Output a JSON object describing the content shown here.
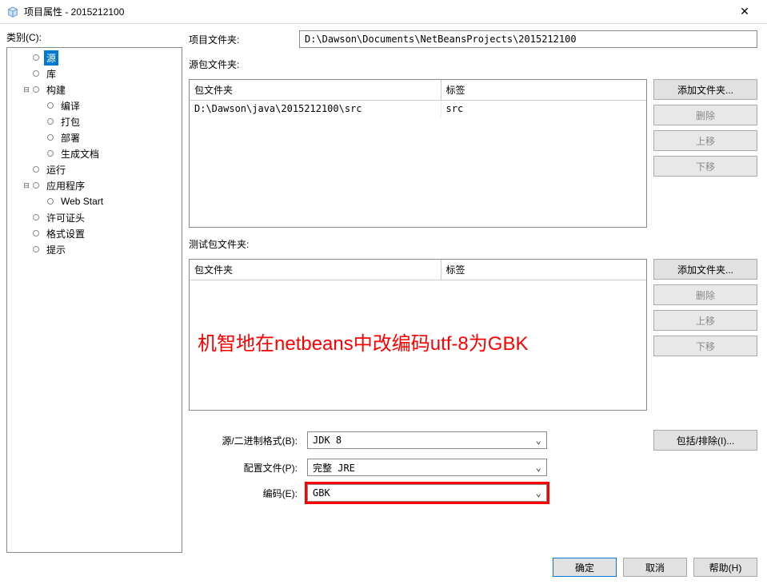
{
  "window": {
    "title": "项目属性 - 2015212100"
  },
  "sidebar": {
    "label": "类别(C):",
    "items": [
      {
        "label": "源",
        "depth": 1,
        "selected": true
      },
      {
        "label": "库",
        "depth": 1
      },
      {
        "label": "构建",
        "depth": 1,
        "expandable": true,
        "expanded": true
      },
      {
        "label": "编译",
        "depth": 2
      },
      {
        "label": "打包",
        "depth": 2
      },
      {
        "label": "部署",
        "depth": 2
      },
      {
        "label": "生成文档",
        "depth": 2
      },
      {
        "label": "运行",
        "depth": 1
      },
      {
        "label": "应用程序",
        "depth": 1,
        "expandable": true,
        "expanded": true
      },
      {
        "label": "Web Start",
        "depth": 2
      },
      {
        "label": "许可证头",
        "depth": 1
      },
      {
        "label": "格式设置",
        "depth": 1
      },
      {
        "label": "提示",
        "depth": 1
      }
    ]
  },
  "main": {
    "project_folder_label": "项目文件夹:",
    "project_folder_value": "D:\\Dawson\\Documents\\NetBeansProjects\\2015212100",
    "source_pkg_label": "源包文件夹:",
    "test_pkg_label": "测试包文件夹:",
    "table_headers": {
      "folder": "包文件夹",
      "tag": "标签"
    },
    "source_rows": [
      {
        "folder": "D:\\Dawson\\java\\2015212100\\src",
        "tag": "src"
      }
    ],
    "buttons": {
      "add_folder": "添加文件夹...",
      "delete": "删除",
      "move_up": "上移",
      "move_down": "下移",
      "include_exclude": "包括/排除(I)..."
    },
    "binary_format_label": "源/二进制格式(B):",
    "binary_format_value": "JDK 8",
    "profile_label": "配置文件(P):",
    "profile_value": "完整 JRE",
    "encoding_label": "编码(E):",
    "encoding_value": "GBK"
  },
  "annotation": "机智地在netbeans中改编码utf-8为GBK",
  "footer": {
    "ok": "确定",
    "cancel": "取消",
    "help": "帮助(H)"
  }
}
